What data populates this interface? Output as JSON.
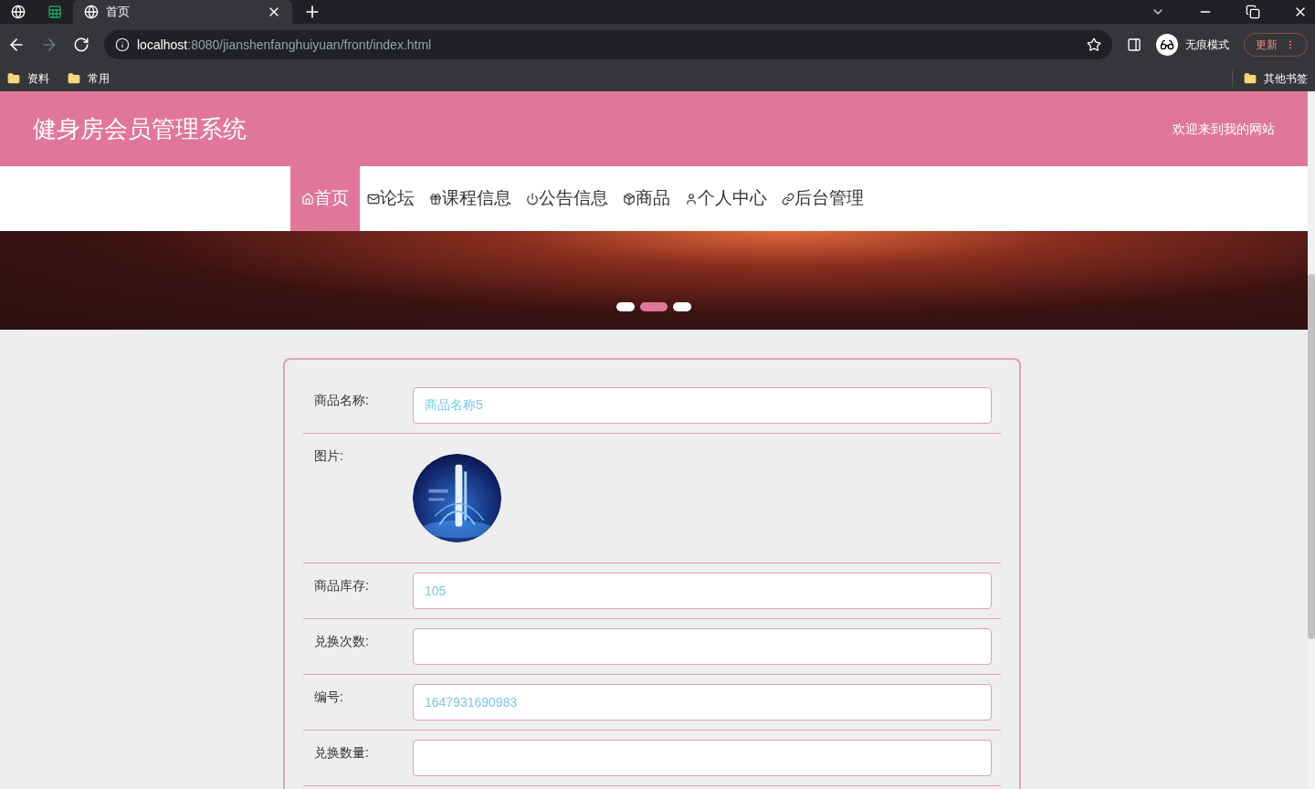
{
  "browser": {
    "tabs": [
      {
        "kind": "pinned",
        "selected": false
      },
      {
        "kind": "pinned-sheet",
        "selected": false
      },
      {
        "kind": "page",
        "title": "首页",
        "selected": true
      }
    ],
    "url_host": "localhost",
    "url_rest": ":8080/jianshenfanghuiyuan/front/index.html",
    "incognito_label": "无痕模式",
    "update_label": "更新",
    "bookmarks": [
      "资料",
      "常用"
    ],
    "other_bookmarks": "其他书签"
  },
  "header": {
    "title": "健身房会员管理系统",
    "welcome": "欢迎来到我的网站"
  },
  "nav": [
    {
      "label": "首页",
      "selected": true
    },
    {
      "label": "论坛",
      "selected": false
    },
    {
      "label": "课程信息",
      "selected": false
    },
    {
      "label": "公告信息",
      "selected": false
    },
    {
      "label": "商品",
      "selected": false
    },
    {
      "label": "个人中心",
      "selected": false
    },
    {
      "label": "后台管理",
      "selected": false
    }
  ],
  "carousel": {
    "dots": [
      {
        "selected": false
      },
      {
        "selected": true
      },
      {
        "selected": false
      }
    ]
  },
  "form": {
    "fields": [
      {
        "kind": "text",
        "label": "商品名称:",
        "value": "商品名称5"
      },
      {
        "label": "图片:"
      },
      {
        "kind": "text",
        "label": "商品库存:",
        "value": "105"
      },
      {
        "kind": "text",
        "label": "兑换次数:"
      },
      {
        "kind": "text",
        "label": "编号:",
        "value": "1647931690983"
      },
      {
        "kind": "text",
        "label": "兑换数量:"
      }
    ]
  }
}
